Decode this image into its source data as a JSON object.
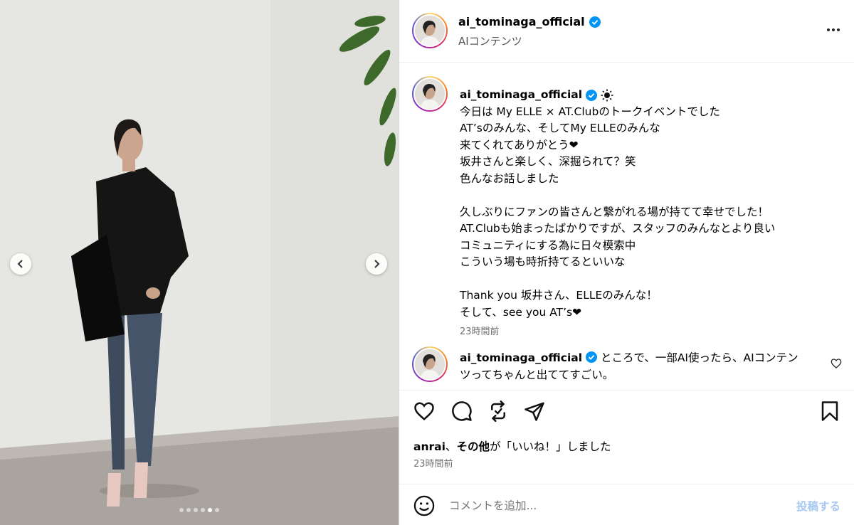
{
  "post": {
    "username": "ai_tominaga_official",
    "subtitle": "AIコンテンツ",
    "carousel_dots": 6,
    "carousel_active_index": 4
  },
  "caption": {
    "username": "ai_tominaga_official",
    "lines": [
      "今日は My ELLE × AT.Clubのトークイベントでした",
      "AT’sのみんな、そしてMy ELLEのみんな",
      "来てくれてありがとう❤",
      "坂井さんと楽しく、深掘られて？笑",
      "色んなお話しました",
      "",
      "久しぶりにファンの皆さんと繋がれる場が持てて幸せでした！",
      "AT.Clubも始まったばかりですが、スタッフのみんなとより良い",
      "コミュニティにする為に日々模索中",
      "こういう場も時折持てるといいな",
      "",
      "Thank you 坂井さん、ELLEのみんな！",
      "そして、see you AT’s❤"
    ],
    "time": "23時間前"
  },
  "reply": {
    "username": "ai_tominaga_official",
    "text": "ところで、一部AI使ったら、AIコンテンツってちゃんと出ててすごい。"
  },
  "likes": {
    "user": "anrai",
    "separator": "、",
    "others": "その他",
    "suffix": "が「いいね！」しました"
  },
  "post_time": "23時間前",
  "comment_box": {
    "placeholder": "コメントを追加...",
    "post_label": "投稿する"
  },
  "icons": {
    "verified": "verified-badge-icon",
    "sun": "sun-icon",
    "heart": "heart-icon",
    "comment": "comment-icon",
    "repost": "repost-icon",
    "share": "share-icon",
    "save": "bookmark-icon",
    "emoji": "emoji-icon",
    "more": "more-options-icon",
    "prev": "chevron-left-icon",
    "next": "chevron-right-icon"
  },
  "colors": {
    "verified": "#0095f6",
    "post_button": "#a7c8f0",
    "secondary_text": "#737373"
  }
}
